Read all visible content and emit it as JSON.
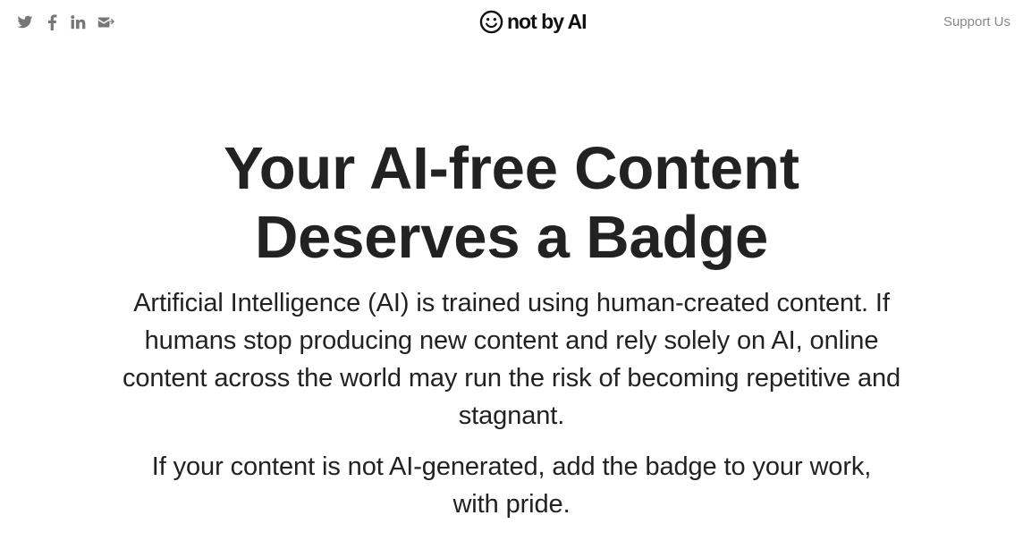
{
  "header": {
    "social_links": [
      {
        "name": "twitter-icon"
      },
      {
        "name": "facebook-icon"
      },
      {
        "name": "linkedin-icon"
      },
      {
        "name": "email-share-icon"
      }
    ],
    "brand": {
      "icon": "smile-face-icon",
      "text": "not by AI"
    },
    "support_label": "Support Us"
  },
  "hero": {
    "title": "Your AI-free Content Deserves a Badge",
    "paragraph_1": "Artificial Intelligence (AI) is trained using human-created content. If humans stop producing new content and rely solely on AI, online content across the world may run the risk of becoming repetitive and stagnant.",
    "paragraph_2": "If your content is not AI-generated, add the badge to your work, with pride."
  },
  "colors": {
    "background": "#ffffff",
    "text_primary": "#222222",
    "text_muted": "#888888",
    "icon_muted": "#777777"
  }
}
